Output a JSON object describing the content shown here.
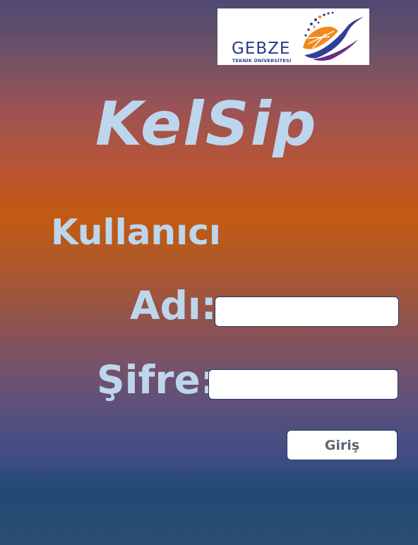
{
  "logo": {
    "name": "GEBZE",
    "subtitle": "TEKNİK ÜNİVERSİTESİ"
  },
  "app": {
    "title": "KelSip"
  },
  "form": {
    "username_label_line1": "Kullanıcı",
    "username_label_line2": "Adı:",
    "password_label": "Şifre:",
    "username_value": "",
    "password_value": "",
    "submit_label": "Giriş"
  },
  "colors": {
    "label_text": "#bdd6ee",
    "logo_blue": "#263a8c",
    "logo_orange": "#f08a1c",
    "button_text": "#5b6670"
  }
}
